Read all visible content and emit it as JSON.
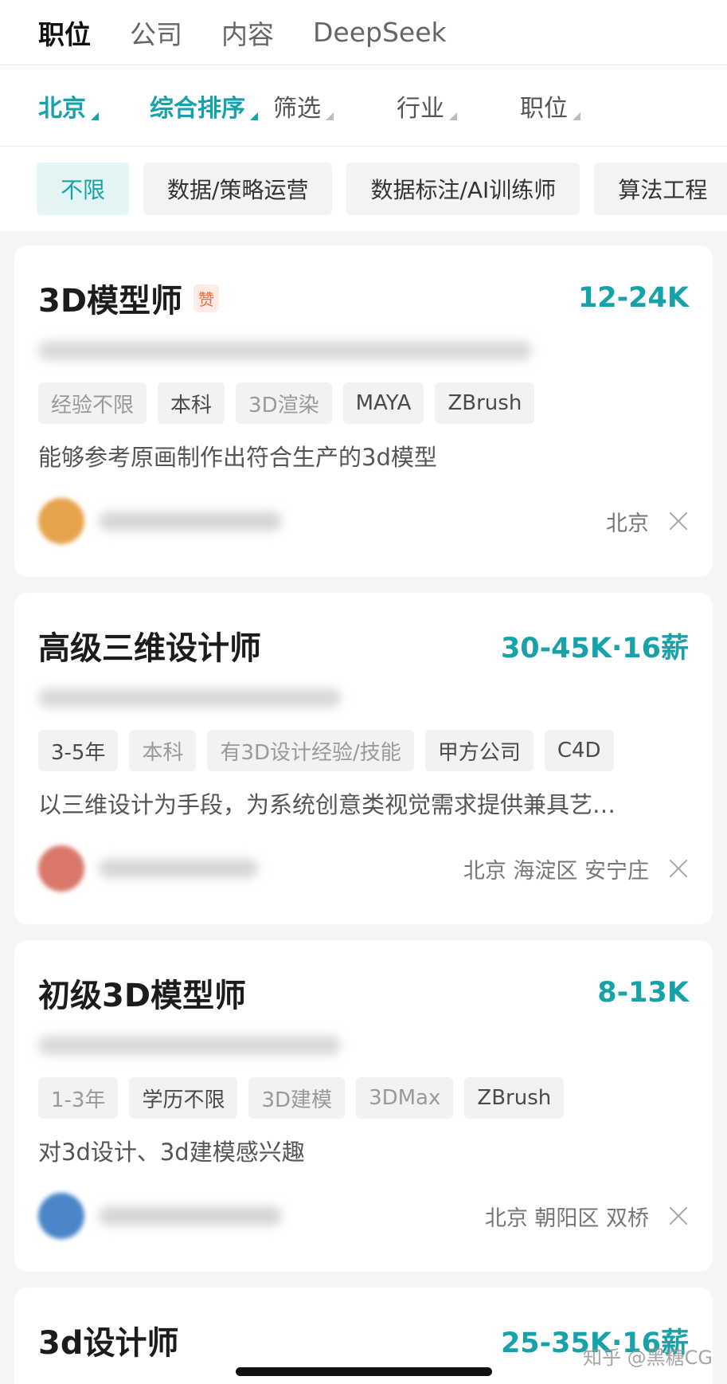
{
  "top_tabs": [
    {
      "label": "职位",
      "active": true
    },
    {
      "label": "公司",
      "active": false
    },
    {
      "label": "内容",
      "active": false
    },
    {
      "label": "DeepSeek",
      "active": false
    }
  ],
  "filters": [
    {
      "label": "北京",
      "active": true
    },
    {
      "label": "综合排序",
      "active": true
    },
    {
      "label": "筛选",
      "active": false
    },
    {
      "label": "行业",
      "active": false
    },
    {
      "label": "职位",
      "active": false
    }
  ],
  "chips": [
    {
      "label": "不限",
      "active": true
    },
    {
      "label": "数据/策略运营",
      "active": false
    },
    {
      "label": "数据标注/AI训练师",
      "active": false
    },
    {
      "label": "算法工程",
      "active": false
    }
  ],
  "jobs": [
    {
      "title": "3D模型师",
      "badge": "赞",
      "salary": "12-24K",
      "tags": [
        "经验不限",
        "本科",
        "3D渲染",
        "MAYA",
        "ZBrush"
      ],
      "desc": "能够参考原画制作出符合生产的3d模型",
      "location": "北京",
      "avatar_color": "#e7a34c"
    },
    {
      "title": "高级三维设计师",
      "salary": "30-45K·16薪",
      "tags": [
        "3-5年",
        "本科",
        "有3D设计经验/技能",
        "甲方公司",
        "C4D"
      ],
      "desc": "以三维设计为手段，为系统创意类视觉需求提供兼具艺…",
      "location": "北京 海淀区 安宁庄",
      "avatar_color": "#d9786a"
    },
    {
      "title": "初级3D模型师",
      "salary": "8-13K",
      "tags": [
        "1-3年",
        "学历不限",
        "3D建模",
        "3DMax",
        "ZBrush"
      ],
      "desc": "对3d设计、3d建模感兴趣",
      "location": "北京 朝阳区 双桥",
      "avatar_color": "#4a86c8"
    },
    {
      "title": "3d设计师",
      "salary": "25-35K·16薪"
    }
  ],
  "watermark": "知乎 @黑糖CG",
  "colors": {
    "accent": "#16a2a8",
    "background": "#f5f5f6"
  }
}
